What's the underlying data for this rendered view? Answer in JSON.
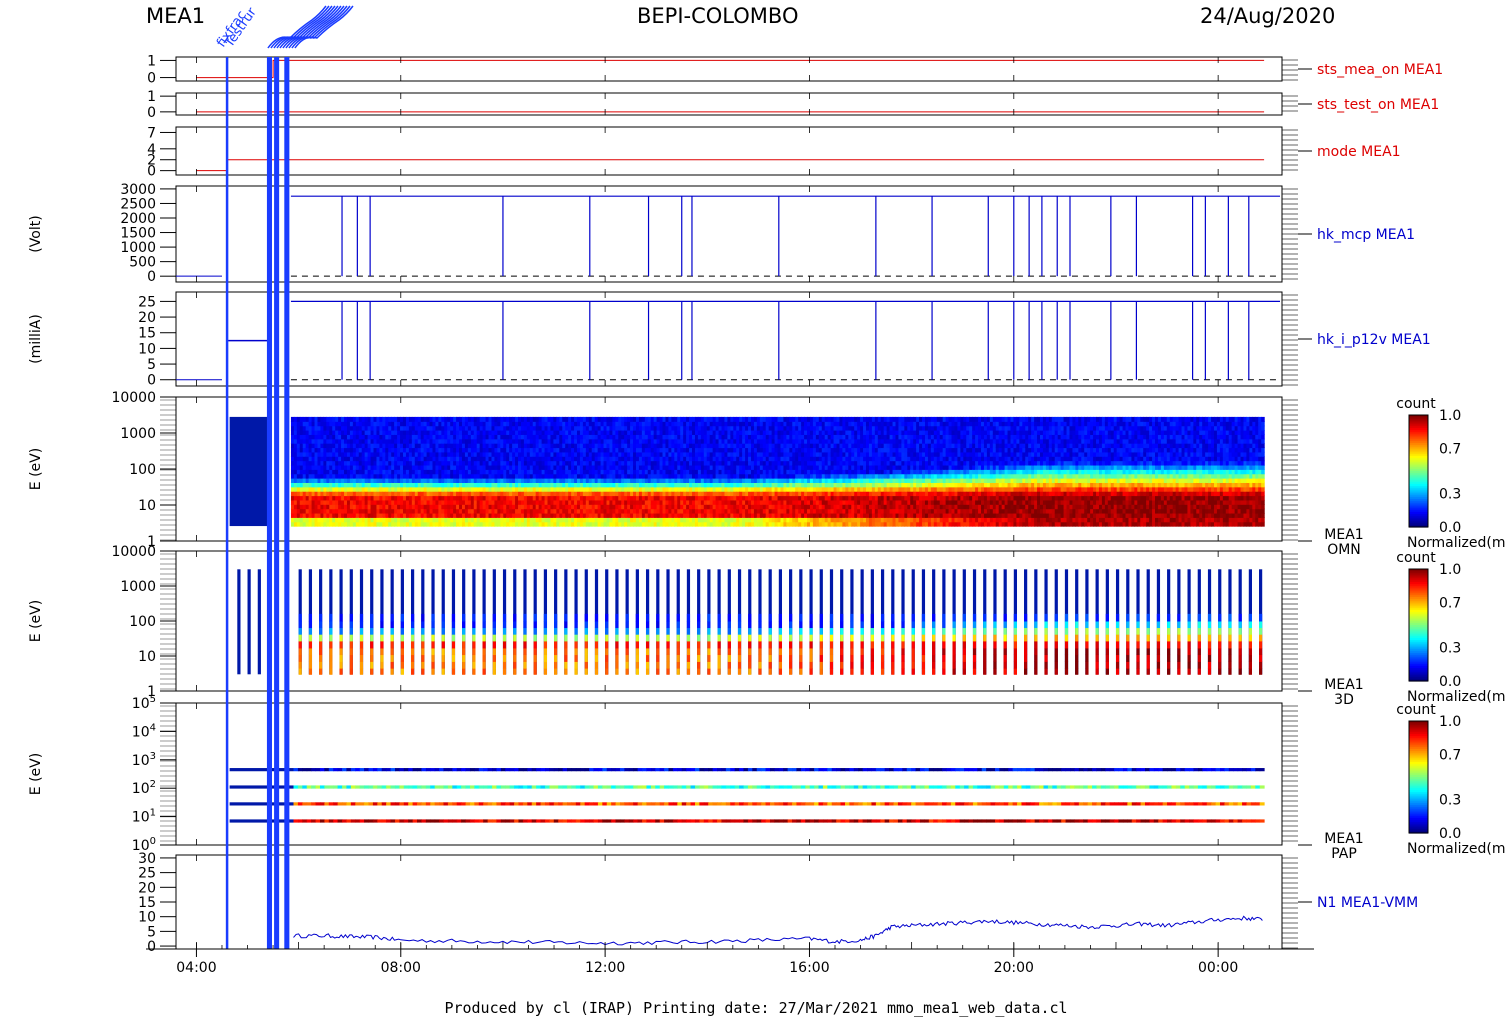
{
  "header": {
    "left": "MEA1",
    "center": "BEPI-COLOMBO",
    "right": "24/Aug/2020"
  },
  "footer": {
    "text": "Produced by cl (IRAP)    Printing date: 27/Mar/2021    mmo_mea1_web_data.cl"
  },
  "colors": {
    "red_series": "#dd0000",
    "blue_series": "#0000cc",
    "event_lines": "#1a3cff"
  },
  "top_event_labels": [
    "fixfrac",
    "Testrur"
  ],
  "chart_data": [
    {
      "id": "sts_mea_on",
      "type": "line",
      "series_label": "sts_mea_on MEA1",
      "ylabel": "",
      "yticks": [
        "1",
        "0"
      ],
      "ylim": [
        -0.2,
        1.2
      ],
      "time_range_hours": [
        3.7,
        24.9
      ],
      "series": [
        {
          "t": [
            4.0,
            5.5,
            5.5,
            24.9
          ],
          "y": [
            0,
            0,
            1,
            1
          ]
        }
      ]
    },
    {
      "id": "sts_test_on",
      "type": "line",
      "series_label": "sts_test_on MEA1",
      "ylabel": "",
      "yticks": [
        "1",
        "0"
      ],
      "ylim": [
        -0.2,
        1.2
      ],
      "series": [
        {
          "t": [
            4.0,
            24.9
          ],
          "y": [
            0,
            0
          ]
        }
      ]
    },
    {
      "id": "mode",
      "type": "line",
      "series_label": "mode MEA1",
      "ylabel": "",
      "yticks": [
        "7",
        "4",
        "2",
        "0"
      ],
      "ylim": [
        -0.8,
        8.0
      ],
      "series": [
        {
          "t": [
            4.0,
            4.6,
            4.6,
            24.9
          ],
          "y": [
            0,
            0,
            2,
            2
          ]
        }
      ]
    },
    {
      "id": "hk_mcp",
      "type": "line",
      "series_label": "hk_mcp MEA1",
      "ylabel": "(Volt)",
      "yticks": [
        "3000",
        "2500",
        "2000",
        "1500",
        "1000",
        "500",
        "0"
      ],
      "ylim": [
        -200,
        3100
      ],
      "level_high": 2750,
      "level_low": 0,
      "dropout_times_hours": [
        6.85,
        7.15,
        7.4,
        10.0,
        11.7,
        12.85,
        13.5,
        13.7,
        15.4,
        17.3,
        18.4,
        19.5,
        20.0,
        20.3,
        20.55,
        20.85,
        21.1,
        21.9,
        22.4,
        23.5,
        23.75,
        24.2,
        24.6
      ],
      "dashed_zero": true
    },
    {
      "id": "hk_i_p12v",
      "type": "line",
      "series_label": "hk_i_p12v MEA1",
      "ylabel": "(milliA)",
      "yticks": [
        "25",
        "20",
        "15",
        "10",
        "5",
        "0"
      ],
      "ylim": [
        -2,
        28
      ],
      "early_level": 12.5,
      "level_high": 25,
      "level_low": 0,
      "dropout_times_hours": [
        6.85,
        7.15,
        7.4,
        10.0,
        11.7,
        12.85,
        13.5,
        13.7,
        15.4,
        17.3,
        18.4,
        19.5,
        20.0,
        20.3,
        20.55,
        20.85,
        21.1,
        21.9,
        22.4,
        23.5,
        23.75,
        24.2,
        24.6
      ],
      "dashed_zero": true
    },
    {
      "id": "omni_spectrogram",
      "type": "heatmap",
      "ylabel": "E (eV)",
      "yticks": [
        "10000",
        "1000",
        "100",
        "10",
        "1"
      ],
      "scale": "log",
      "ylim_eV": [
        1,
        10000
      ],
      "side_label": [
        "MEA1",
        "OMN"
      ],
      "colorbar": {
        "title": "count",
        "ticks": [
          "1.0",
          "0.7",
          "0.3",
          "0.0"
        ],
        "label": "Normalized(m"
      }
    },
    {
      "id": "3d_spectrogram",
      "type": "heatmap",
      "ylabel": "E (eV)",
      "yticks": [
        "10000",
        "1000",
        "100",
        "10",
        "1"
      ],
      "scale": "log",
      "ylim_eV": [
        1,
        10000
      ],
      "side_label": [
        "MEA1",
        "3D"
      ],
      "colorbar": {
        "title": "count",
        "ticks": [
          "1.0",
          "0.7",
          "0.3",
          "0.0"
        ],
        "label": "Normalized(m"
      }
    },
    {
      "id": "pap_spectrogram",
      "type": "heatmap",
      "ylabel": "E (eV)",
      "yticks": [
        "10",
        "10",
        "10",
        "10",
        "10",
        "10"
      ],
      "ytick_exponents": [
        "5",
        "4",
        "3",
        "2",
        "1",
        "0"
      ],
      "scale": "log",
      "ylim_eV": [
        1,
        100000
      ],
      "band_energies_eV": [
        450,
        110,
        28,
        7
      ],
      "side_label": [
        "MEA1",
        "PAP"
      ],
      "colorbar": {
        "title": "count",
        "ticks": [
          "1.0",
          "0.7",
          "0.3",
          "0.0"
        ],
        "label": "Normalized(m"
      }
    },
    {
      "id": "n1_vmm",
      "type": "line",
      "series_label": "N1 MEA1-VMM",
      "ylabel": "",
      "yticks": [
        "30",
        "25",
        "20",
        "15",
        "10",
        "5",
        "0"
      ],
      "ylim": [
        -1,
        31
      ],
      "series": [
        {
          "t": [
            5.9,
            6.5,
            7.0,
            7.5,
            8.0,
            9.0,
            10.0,
            11.0,
            12.0,
            13.0,
            14.0,
            15.0,
            16.0,
            16.5,
            17.0,
            17.3,
            17.6,
            18.0,
            18.5,
            19.0,
            19.5,
            20.0,
            20.5,
            21.0,
            21.5,
            22.0,
            22.5,
            23.0,
            23.5,
            24.0,
            24.5,
            24.9
          ],
          "y": [
            3.5,
            3.5,
            3.2,
            3.0,
            2.0,
            1.7,
            1.5,
            1.2,
            1.0,
            1.2,
            1.5,
            2.0,
            2.5,
            1.5,
            2.0,
            3.5,
            6.5,
            7.0,
            7.5,
            8.0,
            8.5,
            8.0,
            7.5,
            7.0,
            6.5,
            7.0,
            7.5,
            7.0,
            8.0,
            9.0,
            9.5,
            9.0
          ]
        }
      ]
    }
  ],
  "xaxis": {
    "ticks": [
      "04:00",
      "08:00",
      "12:00",
      "16:00",
      "20:00",
      "00:00"
    ],
    "tick_hours": [
      4,
      8,
      12,
      16,
      20,
      24
    ],
    "range_hours": [
      3.6,
      25.25
    ]
  }
}
